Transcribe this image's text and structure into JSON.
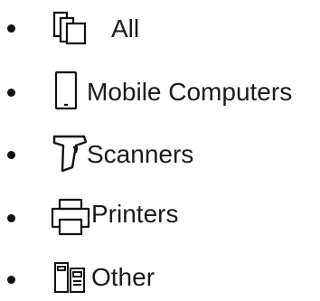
{
  "category_list": {
    "items": [
      {
        "label": "All",
        "icon": "all-devices-icon"
      },
      {
        "label": "Mobile Computers",
        "icon": "mobile-computer-icon"
      },
      {
        "label": "Scanners",
        "icon": "scanner-icon"
      },
      {
        "label": "Printers",
        "icon": "printer-icon"
      },
      {
        "label": "Other",
        "icon": "other-devices-icon"
      }
    ]
  }
}
